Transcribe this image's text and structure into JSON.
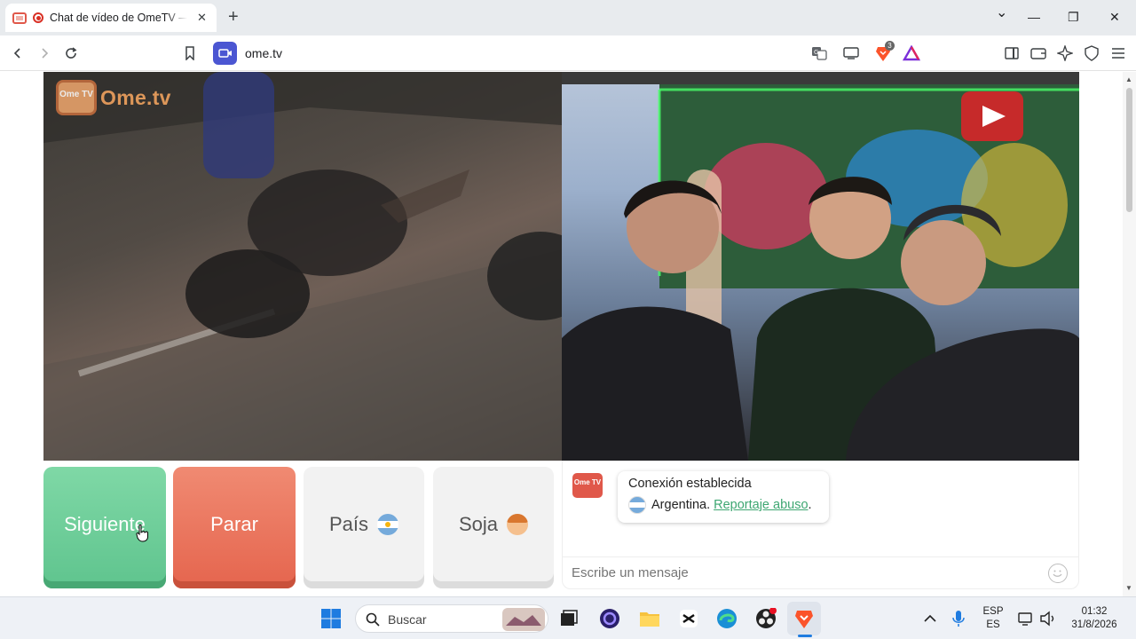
{
  "browser": {
    "tab_title": "Chat de vídeo de OmeTV — A",
    "tab_close": "✕",
    "new_tab": "+",
    "window_controls": {
      "minimize": "—",
      "maximize": "❐",
      "close": "✕",
      "tab_list": "⌄"
    },
    "url": "ome.tv",
    "brave_badge": "3"
  },
  "page": {
    "logo_small": "Ome TV",
    "logo_text": "Ome.tv",
    "buttons": {
      "next": "Siguiente",
      "stop": "Parar",
      "country": "País",
      "gender": "Soja"
    },
    "chat": {
      "logo": "Ome TV",
      "status": "Conexión establecida",
      "country": "Argentina.",
      "report_link": "Reportaje abuso",
      "report_suffix": ".",
      "input_placeholder": "Escribe un mensaje"
    }
  },
  "taskbar": {
    "search_placeholder": "Buscar",
    "language_top": "ESP",
    "language_bottom": "ES",
    "time": "01:32",
    "date": "31/8/2026"
  },
  "colors": {
    "next_button": "#5fc48e",
    "stop_button": "#e5654e",
    "accent_link": "#3ea772",
    "site_badge": "#4b56d2"
  }
}
